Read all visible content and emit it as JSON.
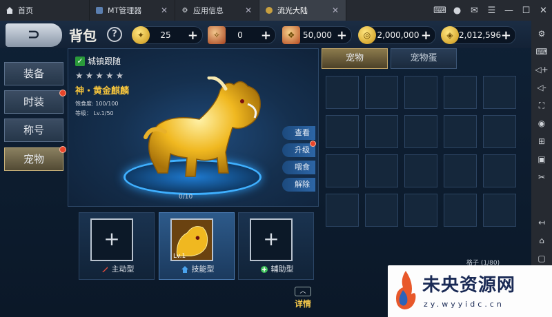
{
  "tabs": [
    {
      "label": "首页",
      "icon": "home-icon",
      "closable": false,
      "active": false
    },
    {
      "label": "MT管理器",
      "icon": "app-icon",
      "closable": true,
      "active": false
    },
    {
      "label": "应用信息",
      "icon": "settings-gear-icon",
      "closable": true,
      "active": false
    },
    {
      "label": "流光大陆",
      "icon": "game-icon",
      "closable": true,
      "active": true
    }
  ],
  "window_controls": [
    "gamepad-icon",
    "user-icon",
    "mail-icon",
    "menu-icon",
    "minimize-icon",
    "maximize-icon",
    "close-icon"
  ],
  "side_toolbar": [
    "settings-icon",
    "keyboard-icon",
    "volume-up-icon",
    "volume-down-icon",
    "fullscreen-icon",
    "record-icon",
    "add-icon",
    "apk-icon",
    "scissors-icon",
    "back-icon",
    "home-icon",
    "multitask-icon"
  ],
  "header": {
    "title": "背包",
    "help_label": "?"
  },
  "resources": [
    {
      "icon": "gold-coin-icon",
      "value": "25"
    },
    {
      "icon": "scroll-icon",
      "value": "0"
    },
    {
      "icon": "ticket-icon",
      "value": "50,000"
    },
    {
      "icon": "silver-coin-icon",
      "value": "2,000,000"
    },
    {
      "icon": "gold-ingot-icon",
      "value": "2,012,596"
    }
  ],
  "side_menu": [
    {
      "label": "装备",
      "badge": false,
      "active": false
    },
    {
      "label": "时装",
      "badge": true,
      "active": false
    },
    {
      "label": "称号",
      "badge": false,
      "active": false
    },
    {
      "label": "宠物",
      "badge": true,
      "active": true
    }
  ],
  "pet": {
    "follow_label": "城镇跟随",
    "stars": "★★★★★",
    "name": "神・黄金麒麟",
    "satiety": "饱食度:     100/100",
    "level": "等级：     Lv.1/50",
    "exp": "0/10",
    "actions": [
      "查看",
      "升级",
      "喂食",
      "解除"
    ]
  },
  "slots": [
    {
      "label": "主动型",
      "filled": false,
      "plus": "+",
      "level": ""
    },
    {
      "label": "技能型",
      "filled": true,
      "plus": "",
      "level": "Lv.1"
    },
    {
      "label": "辅助型",
      "filled": false,
      "plus": "+",
      "level": ""
    }
  ],
  "detail_label": "详情",
  "right_tabs": [
    "宠物",
    "宠物蛋"
  ],
  "capacity": "格子 (1/80)",
  "watermark": {
    "text": "未央资源网",
    "url": "zy.wyyidc.cn"
  },
  "colors": {
    "accent_gold": "#f5c43c",
    "badge_red": "#e8452a",
    "panel_blue": "#15304f"
  }
}
